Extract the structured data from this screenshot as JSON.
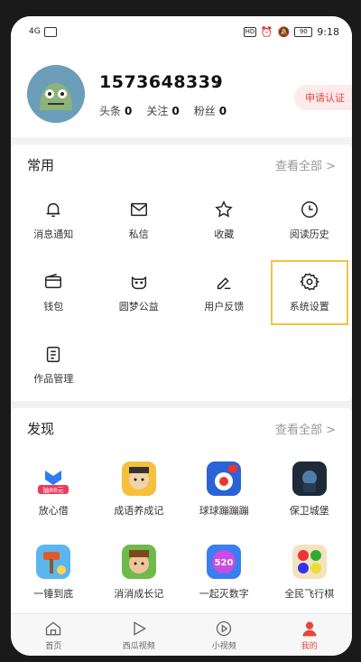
{
  "status_bar": {
    "signal": "4G",
    "hd": "HD",
    "battery": "90",
    "time": "9:18"
  },
  "profile": {
    "username": "1573648339",
    "stats": [
      {
        "label": "头条",
        "value": "0"
      },
      {
        "label": "关注",
        "value": "0"
      },
      {
        "label": "粉丝",
        "value": "0"
      }
    ],
    "verify_label": "申请认证"
  },
  "common": {
    "title": "常用",
    "view_all": "查看全部 >",
    "items": [
      {
        "label": "消息通知",
        "icon": "bell-icon"
      },
      {
        "label": "私信",
        "icon": "mail-icon"
      },
      {
        "label": "收藏",
        "icon": "star-icon"
      },
      {
        "label": "阅读历史",
        "icon": "clock-icon"
      },
      {
        "label": "钱包",
        "icon": "wallet-icon"
      },
      {
        "label": "圆梦公益",
        "icon": "charity-icon"
      },
      {
        "label": "用户反馈",
        "icon": "feedback-pen-icon"
      },
      {
        "label": "系统设置",
        "icon": "gear-icon"
      },
      {
        "label": "作品管理",
        "icon": "document-list-icon"
      }
    ]
  },
  "discover": {
    "title": "发现",
    "view_all": "查看全部 >",
    "items": [
      {
        "label": "放心借",
        "icon": "loan-app-icon",
        "badge": "抽88元"
      },
      {
        "label": "成语养成记",
        "icon": "idiom-game-icon"
      },
      {
        "label": "球球蹦蹦蹦",
        "icon": "ball-game-icon"
      },
      {
        "label": "保卫城堡",
        "icon": "castle-game-icon"
      },
      {
        "label": "一锤到底",
        "icon": "hammer-game-icon"
      },
      {
        "label": "消消成长记",
        "icon": "match-game-icon"
      },
      {
        "label": "一起灭数字",
        "icon": "number-game-icon",
        "badge": "520"
      },
      {
        "label": "全民飞行棋",
        "icon": "flight-chess-icon"
      }
    ]
  },
  "tabbar": [
    {
      "label": "首页",
      "icon": "home-icon"
    },
    {
      "label": "西瓜视频",
      "icon": "play-icon"
    },
    {
      "label": "小视频",
      "icon": "short-video-icon"
    },
    {
      "label": "我的",
      "icon": "person-icon"
    }
  ]
}
